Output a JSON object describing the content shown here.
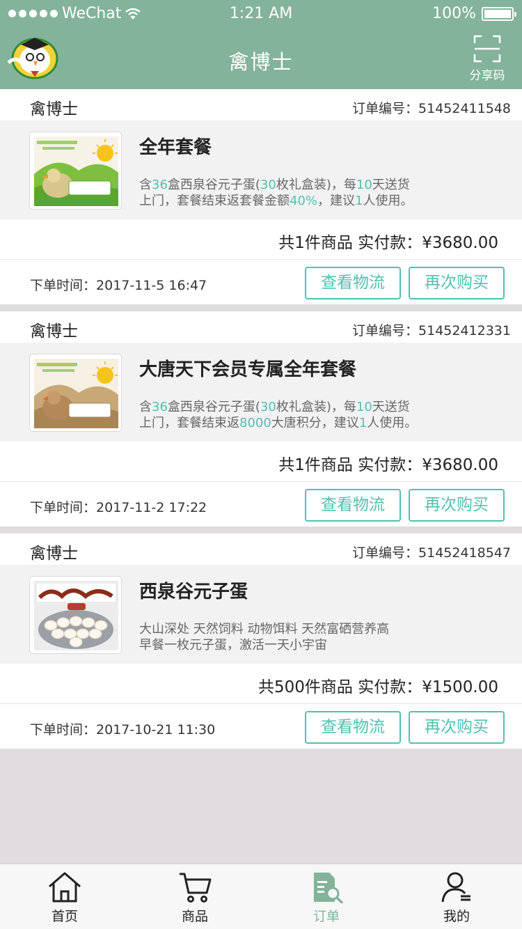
{
  "status_bar": {
    "carrier": "WeChat",
    "time": "1:21 AM",
    "battery": "100%"
  },
  "header": {
    "title": "禽博士",
    "share_label": "分享码"
  },
  "order_no_label": "订单编号：",
  "order_time_label": "下单时间：",
  "orders": [
    {
      "shop": "禽博士",
      "order_no": "51452411548",
      "product_name": "全年套餐",
      "desc_line1": [
        {
          "t": "含",
          "h": false
        },
        {
          "t": "36",
          "h": true
        },
        {
          "t": "盒西泉谷元子蛋(",
          "h": false
        },
        {
          "t": "30",
          "h": true
        },
        {
          "t": "枚礼盒装)，每",
          "h": false
        },
        {
          "t": "10",
          "h": true
        },
        {
          "t": "天送货",
          "h": false
        }
      ],
      "desc_line2": [
        {
          "t": "上门，套餐结束返套餐金额",
          "h": false
        },
        {
          "t": "40%",
          "h": true
        },
        {
          "t": "，建议",
          "h": false
        },
        {
          "t": "1",
          "h": true
        },
        {
          "t": "人使用。",
          "h": false
        }
      ],
      "total": "共1件商品 实付款：¥3680.00",
      "order_time": "2017-11-5  16:47",
      "btn_logistics": "查看物流",
      "btn_rebuy": "再次购买",
      "thumb": "sun-hen-poster"
    },
    {
      "shop": "禽博士",
      "order_no": "51452412331",
      "product_name": "大唐天下会员专属全年套餐",
      "desc_line1": [
        {
          "t": "含",
          "h": false
        },
        {
          "t": "36",
          "h": true
        },
        {
          "t": "盒西泉谷元子蛋(",
          "h": false
        },
        {
          "t": "30",
          "h": true
        },
        {
          "t": "枚礼盒装)，每",
          "h": false
        },
        {
          "t": "10",
          "h": true
        },
        {
          "t": "天送货",
          "h": false
        }
      ],
      "desc_line2": [
        {
          "t": "上门，套餐结束返",
          "h": false
        },
        {
          "t": "8000",
          "h": true
        },
        {
          "t": "大唐积分，建议",
          "h": false
        },
        {
          "t": "1",
          "h": true
        },
        {
          "t": "人使用。",
          "h": false
        }
      ],
      "total": "共1件商品 实付款：¥3680.00",
      "order_time": "2017-11-2 17:22",
      "btn_logistics": "查看物流",
      "btn_rebuy": "再次购买",
      "thumb": "sun-hen-poster-tan"
    },
    {
      "shop": "禽博士",
      "order_no": "51452418547",
      "product_name": "西泉谷元子蛋",
      "desc_line1": [
        {
          "t": "大山深处 天然饲料 动物饵料 天然富硒营养高",
          "h": false
        }
      ],
      "desc_line2": [
        {
          "t": "早餐一枚元子蛋，激活一天小宇宙",
          "h": false
        }
      ],
      "total": "共500件商品 实付款：¥1500.00",
      "order_time": "2017-10-21  11:30",
      "btn_logistics": "查看物流",
      "btn_rebuy": "再次购买",
      "thumb": "egg-tray"
    }
  ],
  "tabs": [
    {
      "label": "首页",
      "icon": "home-icon",
      "active": false
    },
    {
      "label": "商品",
      "icon": "cart-icon",
      "active": false
    },
    {
      "label": "订单",
      "icon": "order-search-icon",
      "active": true
    },
    {
      "label": "我的",
      "icon": "user-icon",
      "active": false
    }
  ],
  "colors": {
    "header": "#83b39a",
    "accent": "#4fc1b0",
    "page_bg": "#e0dcdf"
  }
}
